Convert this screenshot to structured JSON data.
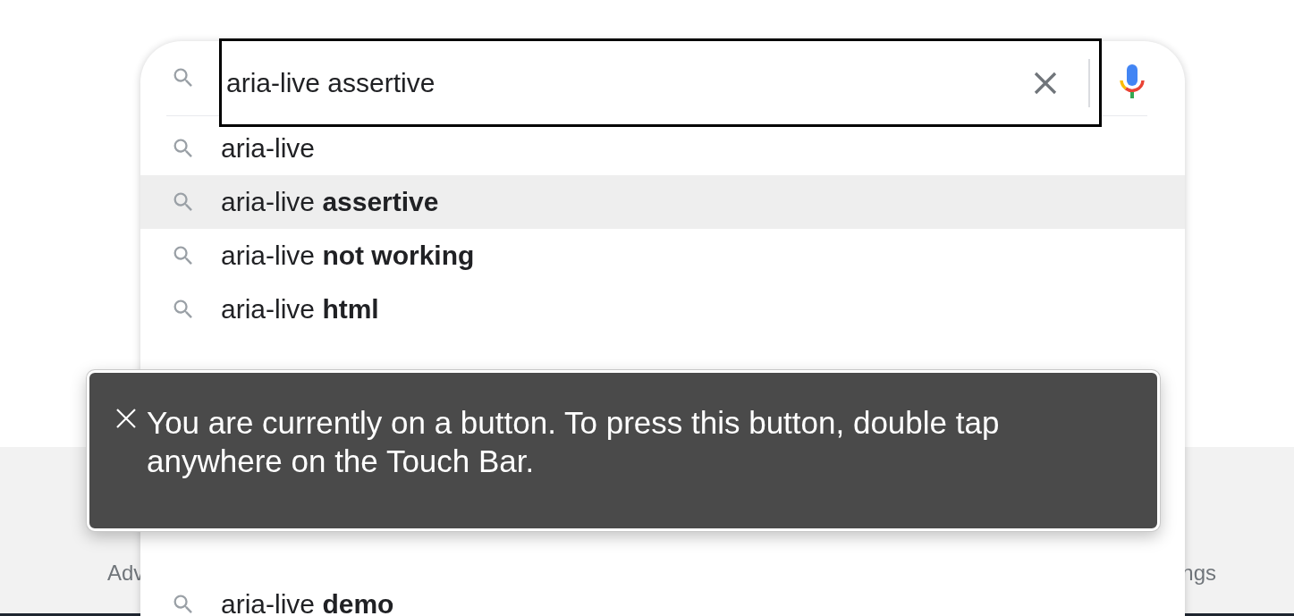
{
  "search": {
    "value": "aria-live assertive"
  },
  "suggestions_above_overlay": [
    {
      "text": "aria-live",
      "selected": false
    },
    {
      "text": "aria-live **assertive**",
      "selected": true
    },
    {
      "text": "aria-live **not working**",
      "selected": false
    },
    {
      "text": "aria-live **html**",
      "selected": false
    }
  ],
  "suggestions_below_overlay": [
    {
      "text": "aria-live **demo**",
      "selected": false
    }
  ],
  "footer": {
    "left_link": "Adv",
    "right_link": "ngs"
  },
  "voiceover_caption": {
    "text": "You are currently on a button. To press this button, double tap anywhere on the Touch Bar."
  }
}
